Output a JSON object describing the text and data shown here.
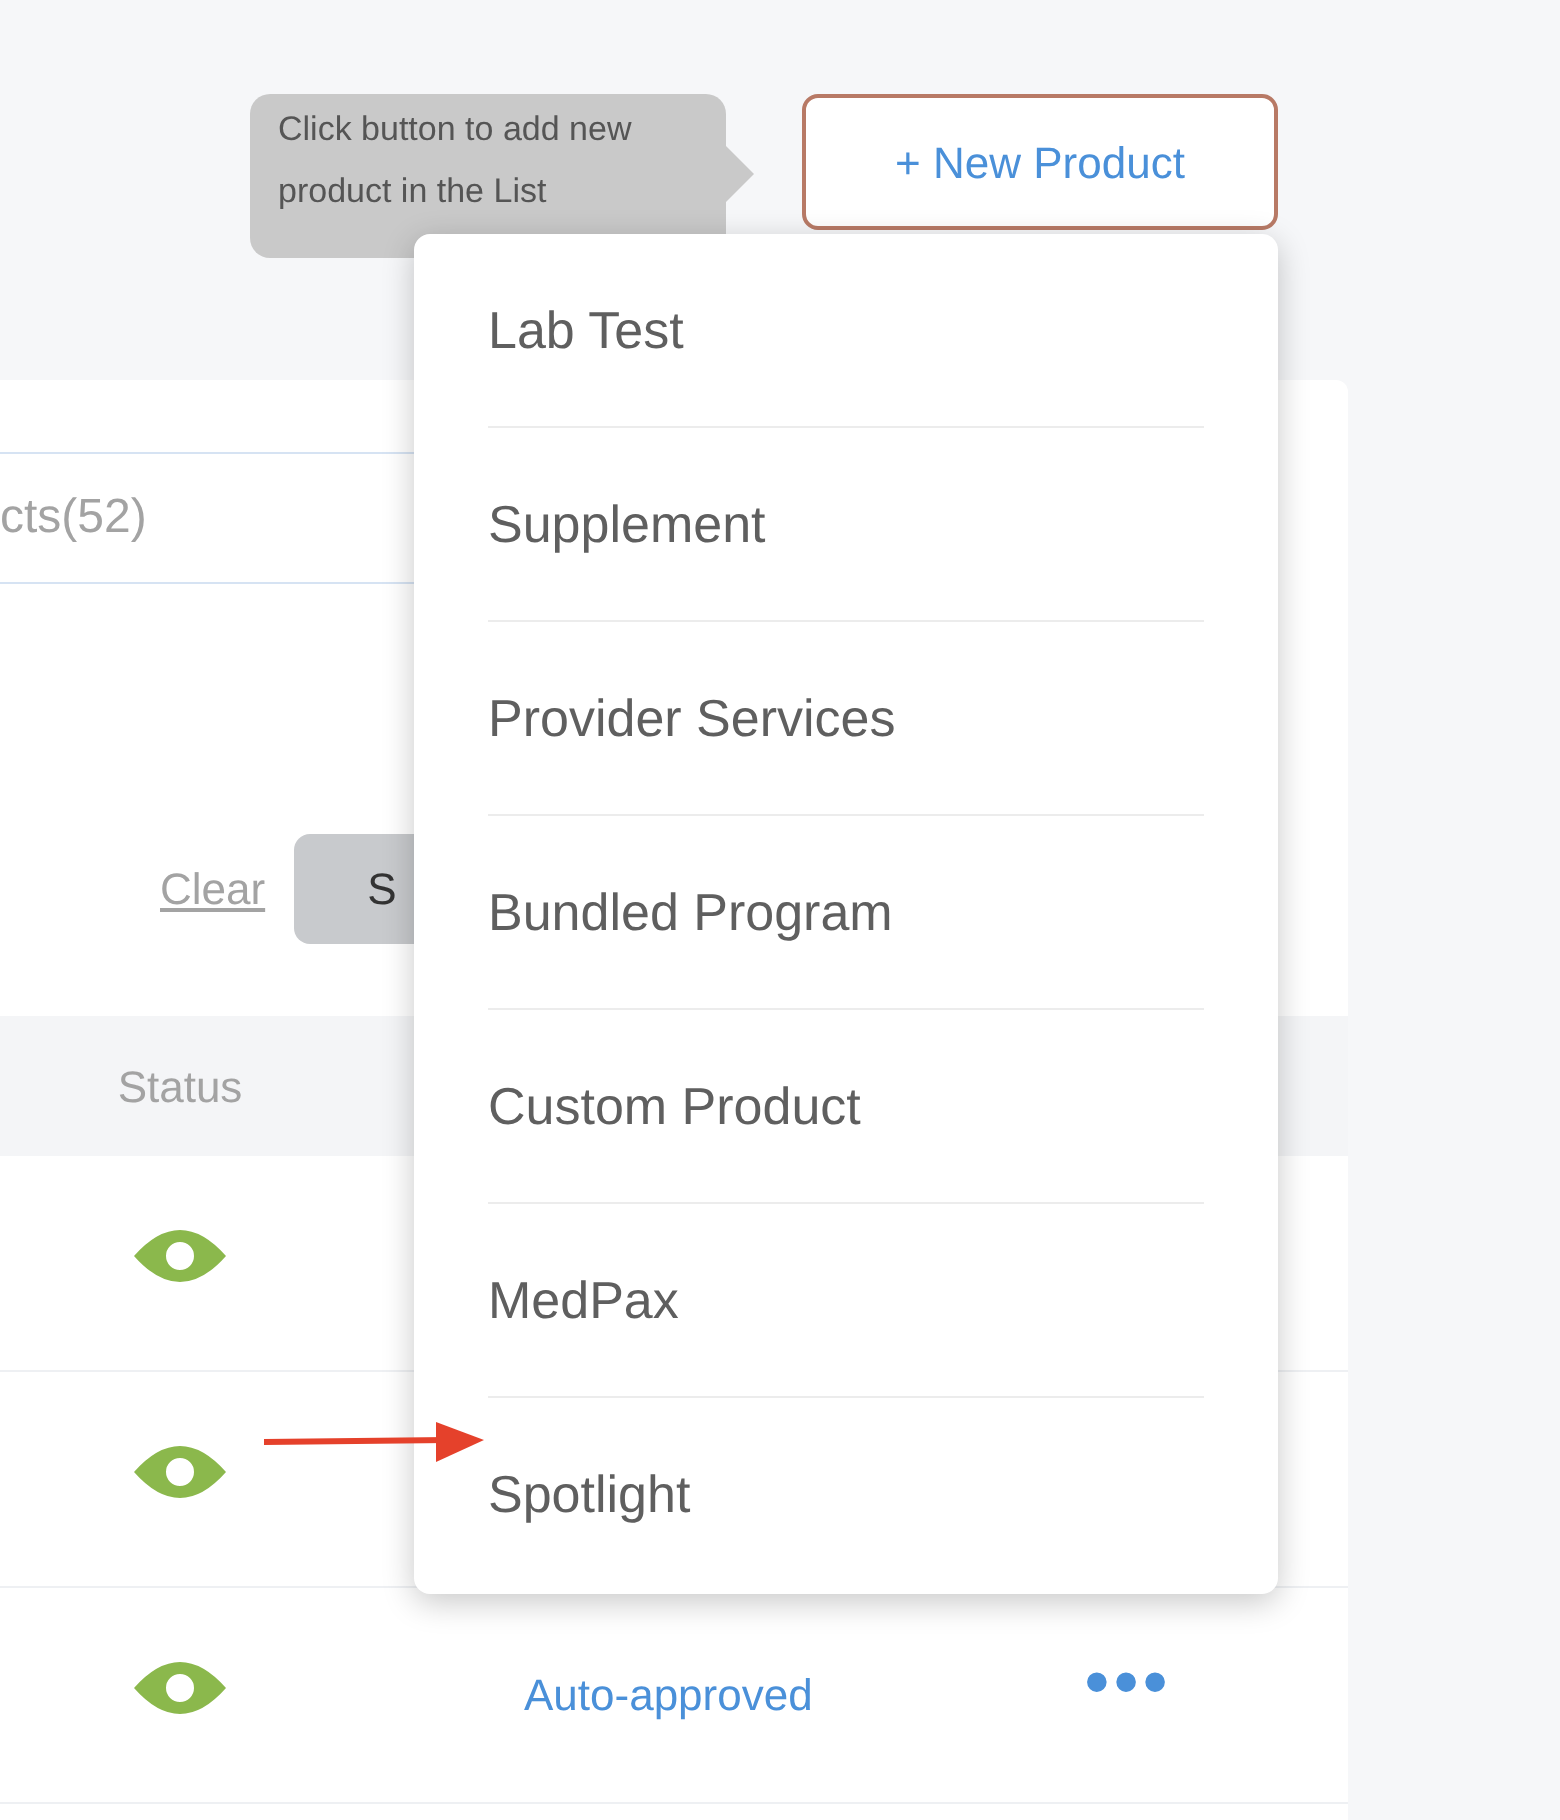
{
  "tooltip": {
    "text": "Click button to add new product in the List"
  },
  "new_product_button": {
    "label": "+ New Product"
  },
  "product_type_menu": {
    "items": [
      {
        "label": "Lab Test"
      },
      {
        "label": "Supplement"
      },
      {
        "label": "Provider Services"
      },
      {
        "label": "Bundled Program"
      },
      {
        "label": "Custom Product"
      },
      {
        "label": "MedPax"
      },
      {
        "label": "Spotlight"
      }
    ]
  },
  "products_panel": {
    "tab": {
      "label": "cts(52)"
    },
    "clear_link": "Clear",
    "action_button": {
      "label": "S"
    }
  },
  "table": {
    "columns": [
      {
        "label": "Status"
      }
    ],
    "rows": [
      {
        "visible": true
      },
      {
        "visible": true
      },
      {
        "visible": true,
        "column_3": "Auto-approved",
        "actions": "•••"
      }
    ]
  }
}
